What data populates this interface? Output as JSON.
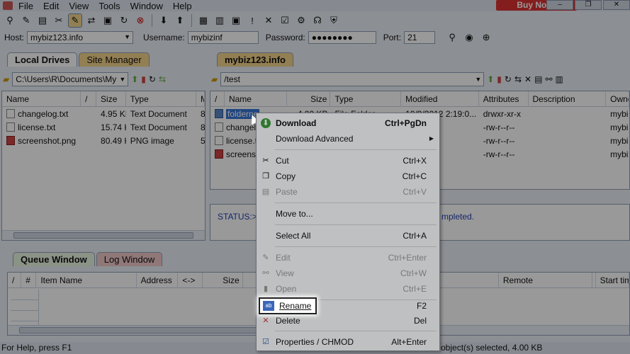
{
  "menu": [
    "File",
    "Edit",
    "View",
    "Tools",
    "Window",
    "Help"
  ],
  "buy_now": "Buy Now!",
  "window_buttons": [
    "–",
    "❐",
    "✕"
  ],
  "connection": {
    "host_label": "Host:",
    "host_value": "mybiz123.info",
    "user_label": "Username:",
    "user_value": "mybizinf",
    "pass_label": "Password:",
    "pass_value": "●●●●●●●●",
    "port_label": "Port:",
    "port_value": "21"
  },
  "left": {
    "tab_local": "Local Drives",
    "tab_site": "Site Manager",
    "path": "C:\\Users\\R\\Documents\\My",
    "columns": [
      "Name",
      "/",
      "Size",
      "Type",
      "M"
    ],
    "files": [
      {
        "name": "changelog.txt",
        "size": "4.95 KB",
        "type": "Text Document",
        "m": "8"
      },
      {
        "name": "license.txt",
        "size": "15.74 KB",
        "type": "Text Document",
        "m": "8/"
      },
      {
        "name": "screenshot.png",
        "size": "80.49 KB",
        "type": "PNG image",
        "m": "5/"
      }
    ]
  },
  "right": {
    "tab": "mybiz123.info",
    "path": "/test",
    "columns": [
      "/",
      "Name",
      "Size",
      "Type",
      "Modified",
      "Attributes",
      "Description",
      "Owne"
    ],
    "files": [
      {
        "name": "folderne",
        "size": "4.00 KB",
        "type": "File Folder",
        "modified": "10/9/2012 2:19:0...",
        "attrs": "drwxr-xr-x",
        "owner": "mybi"
      },
      {
        "name": "changel",
        "size": "",
        "type": "",
        "modified": "1:19:0...",
        "attrs": "-rw-r--r--",
        "owner": "mybi"
      },
      {
        "name": "license.t",
        "size": "",
        "type": "",
        "modified": "1:19:0...",
        "attrs": "-rw-r--r--",
        "owner": "mybi"
      },
      {
        "name": "screensh",
        "size": "",
        "type": "",
        "modified": "1:20:0...",
        "attrs": "-rw-r--r--",
        "owner": "mybi"
      }
    ],
    "status_label": "STATUS:>",
    "status_text": "mpleted."
  },
  "queue": {
    "tab_queue": "Queue Window",
    "tab_log": "Log Window",
    "columns": [
      "/",
      "#",
      "Item Name",
      "Address",
      "<->",
      "Size",
      "Remote",
      "Start tim"
    ]
  },
  "statusbar": {
    "left": "For Help, press F1",
    "right": "object(s) selected, 4.00 KB"
  },
  "context_menu": [
    {
      "label": "Download",
      "key": "Ctrl+PgDn",
      "icon": "download-icon",
      "bold": true,
      "disabled": false
    },
    {
      "label": "Download Advanced",
      "key": "",
      "icon": "",
      "bold": false,
      "disabled": false,
      "submenu": true
    },
    {
      "label": "Cut",
      "key": "Ctrl+X",
      "icon": "scissors-icon",
      "bold": false,
      "disabled": false
    },
    {
      "label": "Copy",
      "key": "Ctrl+C",
      "icon": "copy-icon",
      "bold": false,
      "disabled": false
    },
    {
      "label": "Paste",
      "key": "Ctrl+V",
      "icon": "paste-icon",
      "bold": false,
      "disabled": true
    },
    {
      "label": "Move to...",
      "key": "",
      "icon": "",
      "bold": false,
      "disabled": false
    },
    {
      "label": "Select All",
      "key": "Ctrl+A",
      "icon": "",
      "bold": false,
      "disabled": false
    },
    {
      "label": "Edit",
      "key": "Ctrl+Enter",
      "icon": "edit-icon",
      "bold": false,
      "disabled": true
    },
    {
      "label": "View",
      "key": "Ctrl+W",
      "icon": "view-icon",
      "bold": false,
      "disabled": true
    },
    {
      "label": "Open",
      "key": "Ctrl+E",
      "icon": "open-icon",
      "bold": false,
      "disabled": true
    },
    {
      "label": "Rename",
      "key": "F2",
      "icon": "rename-icon",
      "bold": false,
      "disabled": false
    },
    {
      "label": "Delete",
      "key": "Del",
      "icon": "delete-icon",
      "bold": false,
      "disabled": false
    },
    {
      "label": "Properties / CHMOD",
      "key": "Alt+Enter",
      "icon": "properties-icon",
      "bold": false,
      "disabled": false
    }
  ]
}
